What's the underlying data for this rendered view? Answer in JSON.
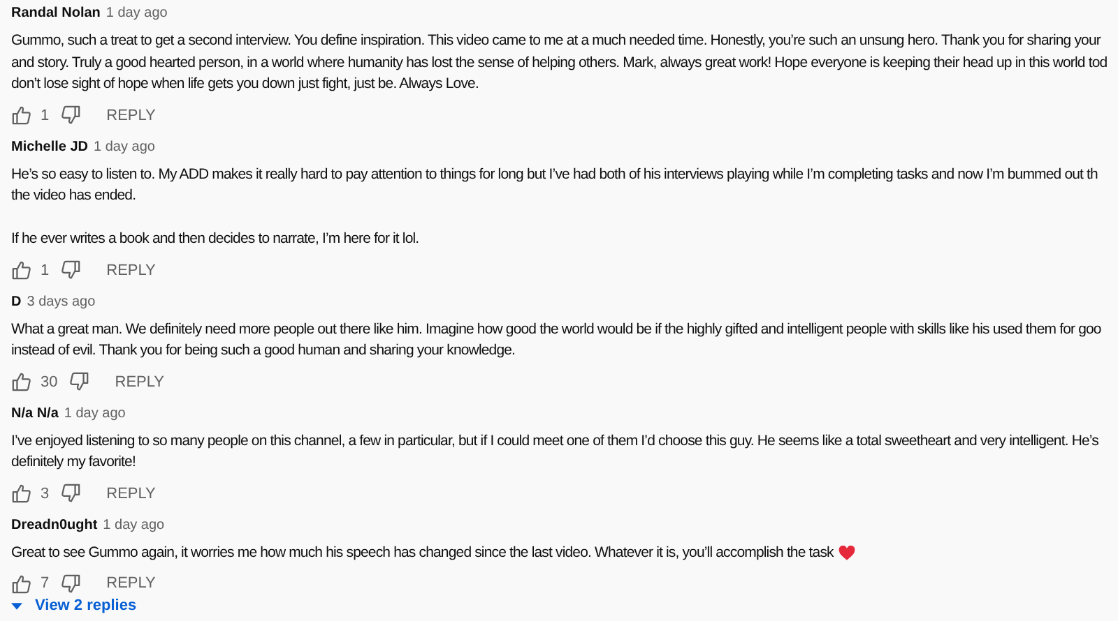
{
  "comments": [
    {
      "author": "Randal Nolan",
      "time": "1 day ago",
      "lines": [
        "Gummo, such a treat to get a second interview. You define inspiration. This video came to me at a much needed time. Honestly, you’re such an unsung hero. Thank you for sharing your",
        "and story. Truly a good hearted person, in a world where humanity has lost the sense of helping others. Mark, always great work! Hope everyone is keeping their head up in this world tod",
        "don’t lose sight of hope when life gets you down just fight, just be. Always Love."
      ],
      "likes": "1",
      "reply": "REPLY"
    },
    {
      "author": "Michelle JD",
      "time": "1 day ago",
      "lines": [
        "He’s so easy to listen to. My ADD makes it really hard to pay attention to things for long but I’ve had both of his interviews playing while I’m completing tasks and now I’m bummed out th",
        "the video has ended."
      ],
      "second_paragraph": "If he ever writes a book and then decides to narrate, I’m here for it lol.",
      "likes": "1",
      "reply": "REPLY"
    },
    {
      "author": "D",
      "time": "3 days ago",
      "lines": [
        "What a great man. We definitely need more people out there like him. Imagine how good the world would be if the highly gifted and intelligent people with skills like his used them for goo",
        "instead of evil. Thank you for being such a good human and sharing your knowledge."
      ],
      "likes": "30",
      "reply": "REPLY"
    },
    {
      "author": "N/a N/a",
      "time": "1 day ago",
      "lines": [
        "I’ve enjoyed listening to so many people on this channel, a few in particular, but if I could meet one of them I’d choose this guy. He seems like a total sweetheart and very intelligent. He’s",
        "definitely my favorite!"
      ],
      "likes": "3",
      "reply": "REPLY"
    },
    {
      "author": "Dreadn0ught",
      "time": "1 day ago",
      "lines": [
        "Great to see Gummo again, it worries me how much his speech has changed since the last video. Whatever it is, you’ll accomplish the task"
      ],
      "heart": true,
      "likes": "7",
      "reply": "REPLY",
      "replies": "View 2 replies"
    }
  ]
}
